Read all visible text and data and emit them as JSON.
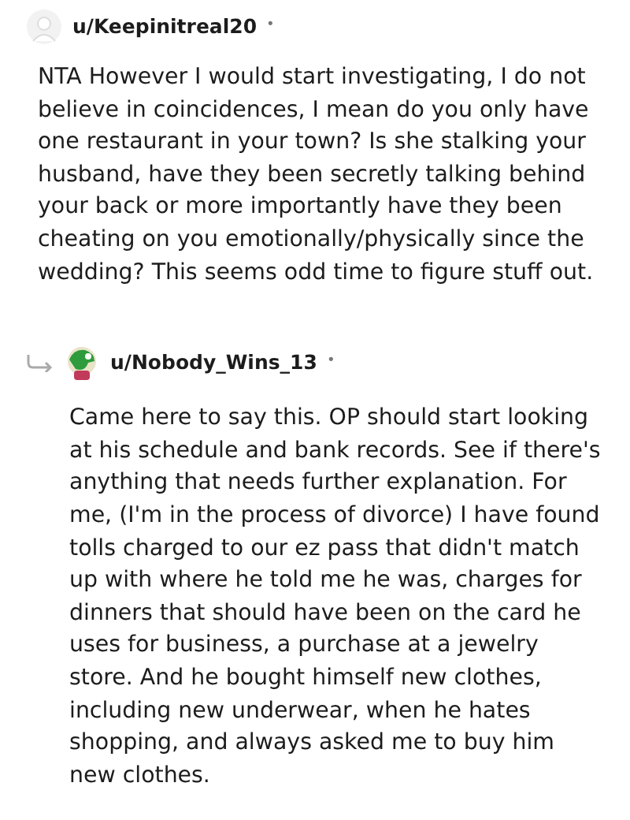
{
  "comments": [
    {
      "username": "u/Keepinitreal20",
      "separator": "•",
      "reply": false,
      "body": "NTA However I would start investigating, I do not believe in coincidences, I mean do you only have one restaurant in your town? Is she stalking your husband, have they been secretly talking behind your back or more importantly have they been cheating on you emotionally/physically since the wedding? This seems odd time to figure stuff out."
    },
    {
      "username": "u/Nobody_Wins_13",
      "separator": "•",
      "reply": true,
      "body": "Came here to say this. OP should start looking at his schedule and bank records. See if there's anything that needs further explanation. For me, (I'm in the process of divorce) I have found tolls charged to our ez pass that didn't match up with where he told me he was, charges for dinners that should have been on the card he uses for business, a purchase at a jewelry store. And he bought himself new clothes, including new underwear, when he hates shopping, and always asked me to buy him new clothes."
    }
  ]
}
